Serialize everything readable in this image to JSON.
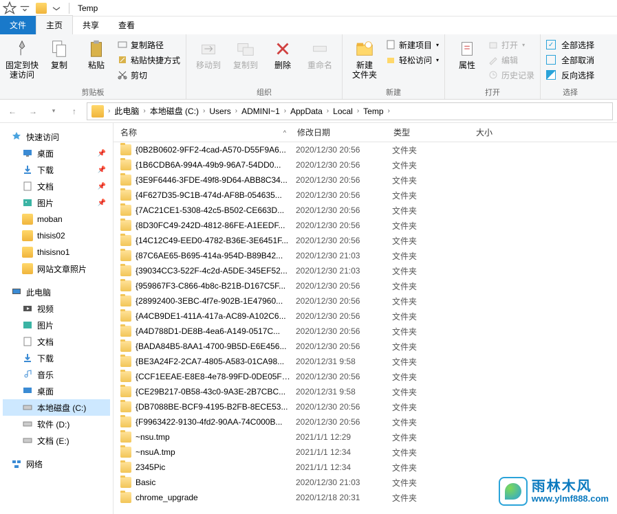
{
  "window": {
    "title": "Temp"
  },
  "tabs": {
    "file": "文件",
    "home": "主页",
    "share": "共享",
    "view": "查看"
  },
  "ribbon": {
    "pin": {
      "label": "固定到快\n速访问"
    },
    "copy": "复制",
    "paste": "粘贴",
    "copy_path": "复制路径",
    "paste_shortcut": "粘贴快捷方式",
    "cut": "剪切",
    "clipboard_group": "剪贴板",
    "move_to": "移动到",
    "copy_to": "复制到",
    "delete": "删除",
    "rename": "重命名",
    "organize_group": "组织",
    "new_folder": "新建\n文件夹",
    "new_item": "新建项目",
    "easy_access": "轻松访问",
    "new_group": "新建",
    "properties": "属性",
    "open": "打开",
    "edit": "编辑",
    "history": "历史记录",
    "open_group": "打开",
    "select_all": "全部选择",
    "select_none": "全部取消",
    "invert_selection": "反向选择",
    "select_group": "选择"
  },
  "breadcrumbs": [
    "此电脑",
    "本地磁盘 (C:)",
    "Users",
    "ADMINI~1",
    "AppData",
    "Local",
    "Temp"
  ],
  "nav": {
    "quick_access": "快速访问",
    "desktop": "桌面",
    "downloads": "下载",
    "documents": "文档",
    "pictures": "图片",
    "moban": "moban",
    "thisis02": "thisis02",
    "thisisno1": "thisisno1",
    "site_photos": "网站文章照片",
    "this_pc": "此电脑",
    "videos": "视频",
    "pictures2": "图片",
    "documents2": "文档",
    "downloads2": "下载",
    "music": "音乐",
    "desktop2": "桌面",
    "disk_c": "本地磁盘 (C:)",
    "disk_d": "软件 (D:)",
    "disk_e": "文档 (E:)",
    "network": "网络"
  },
  "columns": {
    "name": "名称",
    "date": "修改日期",
    "type": "类型",
    "size": "大小"
  },
  "type_folder": "文件夹",
  "files": [
    {
      "name": "{0B2B0602-9FF2-4cad-A570-D55F9A6...",
      "date": "2020/12/30 20:56"
    },
    {
      "name": "{1B6CDB6A-994A-49b9-96A7-54DD0...",
      "date": "2020/12/30 20:56"
    },
    {
      "name": "{3E9F6446-3FDE-49f8-9D64-ABB8C34...",
      "date": "2020/12/30 20:56"
    },
    {
      "name": "{4F627D35-9C1B-474d-AF8B-054635...",
      "date": "2020/12/30 20:56"
    },
    {
      "name": "{7AC21CE1-5308-42c5-B502-CE663D...",
      "date": "2020/12/30 20:56"
    },
    {
      "name": "{8D30FC49-242D-4812-86FE-A1EEDF...",
      "date": "2020/12/30 20:56"
    },
    {
      "name": "{14C12C49-EED0-4782-B36E-3E6451F...",
      "date": "2020/12/30 20:56"
    },
    {
      "name": "{87C6AE65-B695-414a-954D-B89B42...",
      "date": "2020/12/30 21:03"
    },
    {
      "name": "{39034CC3-522F-4c2d-A5DE-345EF52...",
      "date": "2020/12/30 21:03"
    },
    {
      "name": "{959867F3-C866-4b8c-B21B-D167C5F...",
      "date": "2020/12/30 20:56"
    },
    {
      "name": "{28992400-3EBC-4f7e-902B-1E47960...",
      "date": "2020/12/30 20:56"
    },
    {
      "name": "{A4CB9DE1-411A-417a-AC89-A102C6...",
      "date": "2020/12/30 20:56"
    },
    {
      "name": "{A4D788D1-DE8B-4ea6-A149-0517C...",
      "date": "2020/12/30 20:56"
    },
    {
      "name": "{BADA84B5-8AA1-4700-9B5D-E6E456...",
      "date": "2020/12/30 20:56"
    },
    {
      "name": "{BE3A24F2-2CA7-4805-A583-01CA98...",
      "date": "2020/12/31 9:58"
    },
    {
      "name": "{CCF1EEAE-E8E8-4e78-99FD-0DE05F9...",
      "date": "2020/12/30 20:56"
    },
    {
      "name": "{CE29B217-0B58-43c0-9A3E-2B7CBC...",
      "date": "2020/12/31 9:58"
    },
    {
      "name": "{DB7088BE-BCF9-4195-B2FB-8ECE53...",
      "date": "2020/12/30 20:56"
    },
    {
      "name": "{F9963422-9130-4fd2-90AA-74C000B...",
      "date": "2020/12/30 20:56"
    },
    {
      "name": "~nsu.tmp",
      "date": "2021/1/1 12:29"
    },
    {
      "name": "~nsuA.tmp",
      "date": "2021/1/1 12:34"
    },
    {
      "name": "2345Pic",
      "date": "2021/1/1 12:34"
    },
    {
      "name": "Basic",
      "date": "2020/12/30 21:03"
    },
    {
      "name": "chrome_upgrade",
      "date": "2020/12/18 20:31"
    }
  ],
  "watermark": {
    "cn": "雨林木风",
    "url": "www.ylmf888.com"
  }
}
